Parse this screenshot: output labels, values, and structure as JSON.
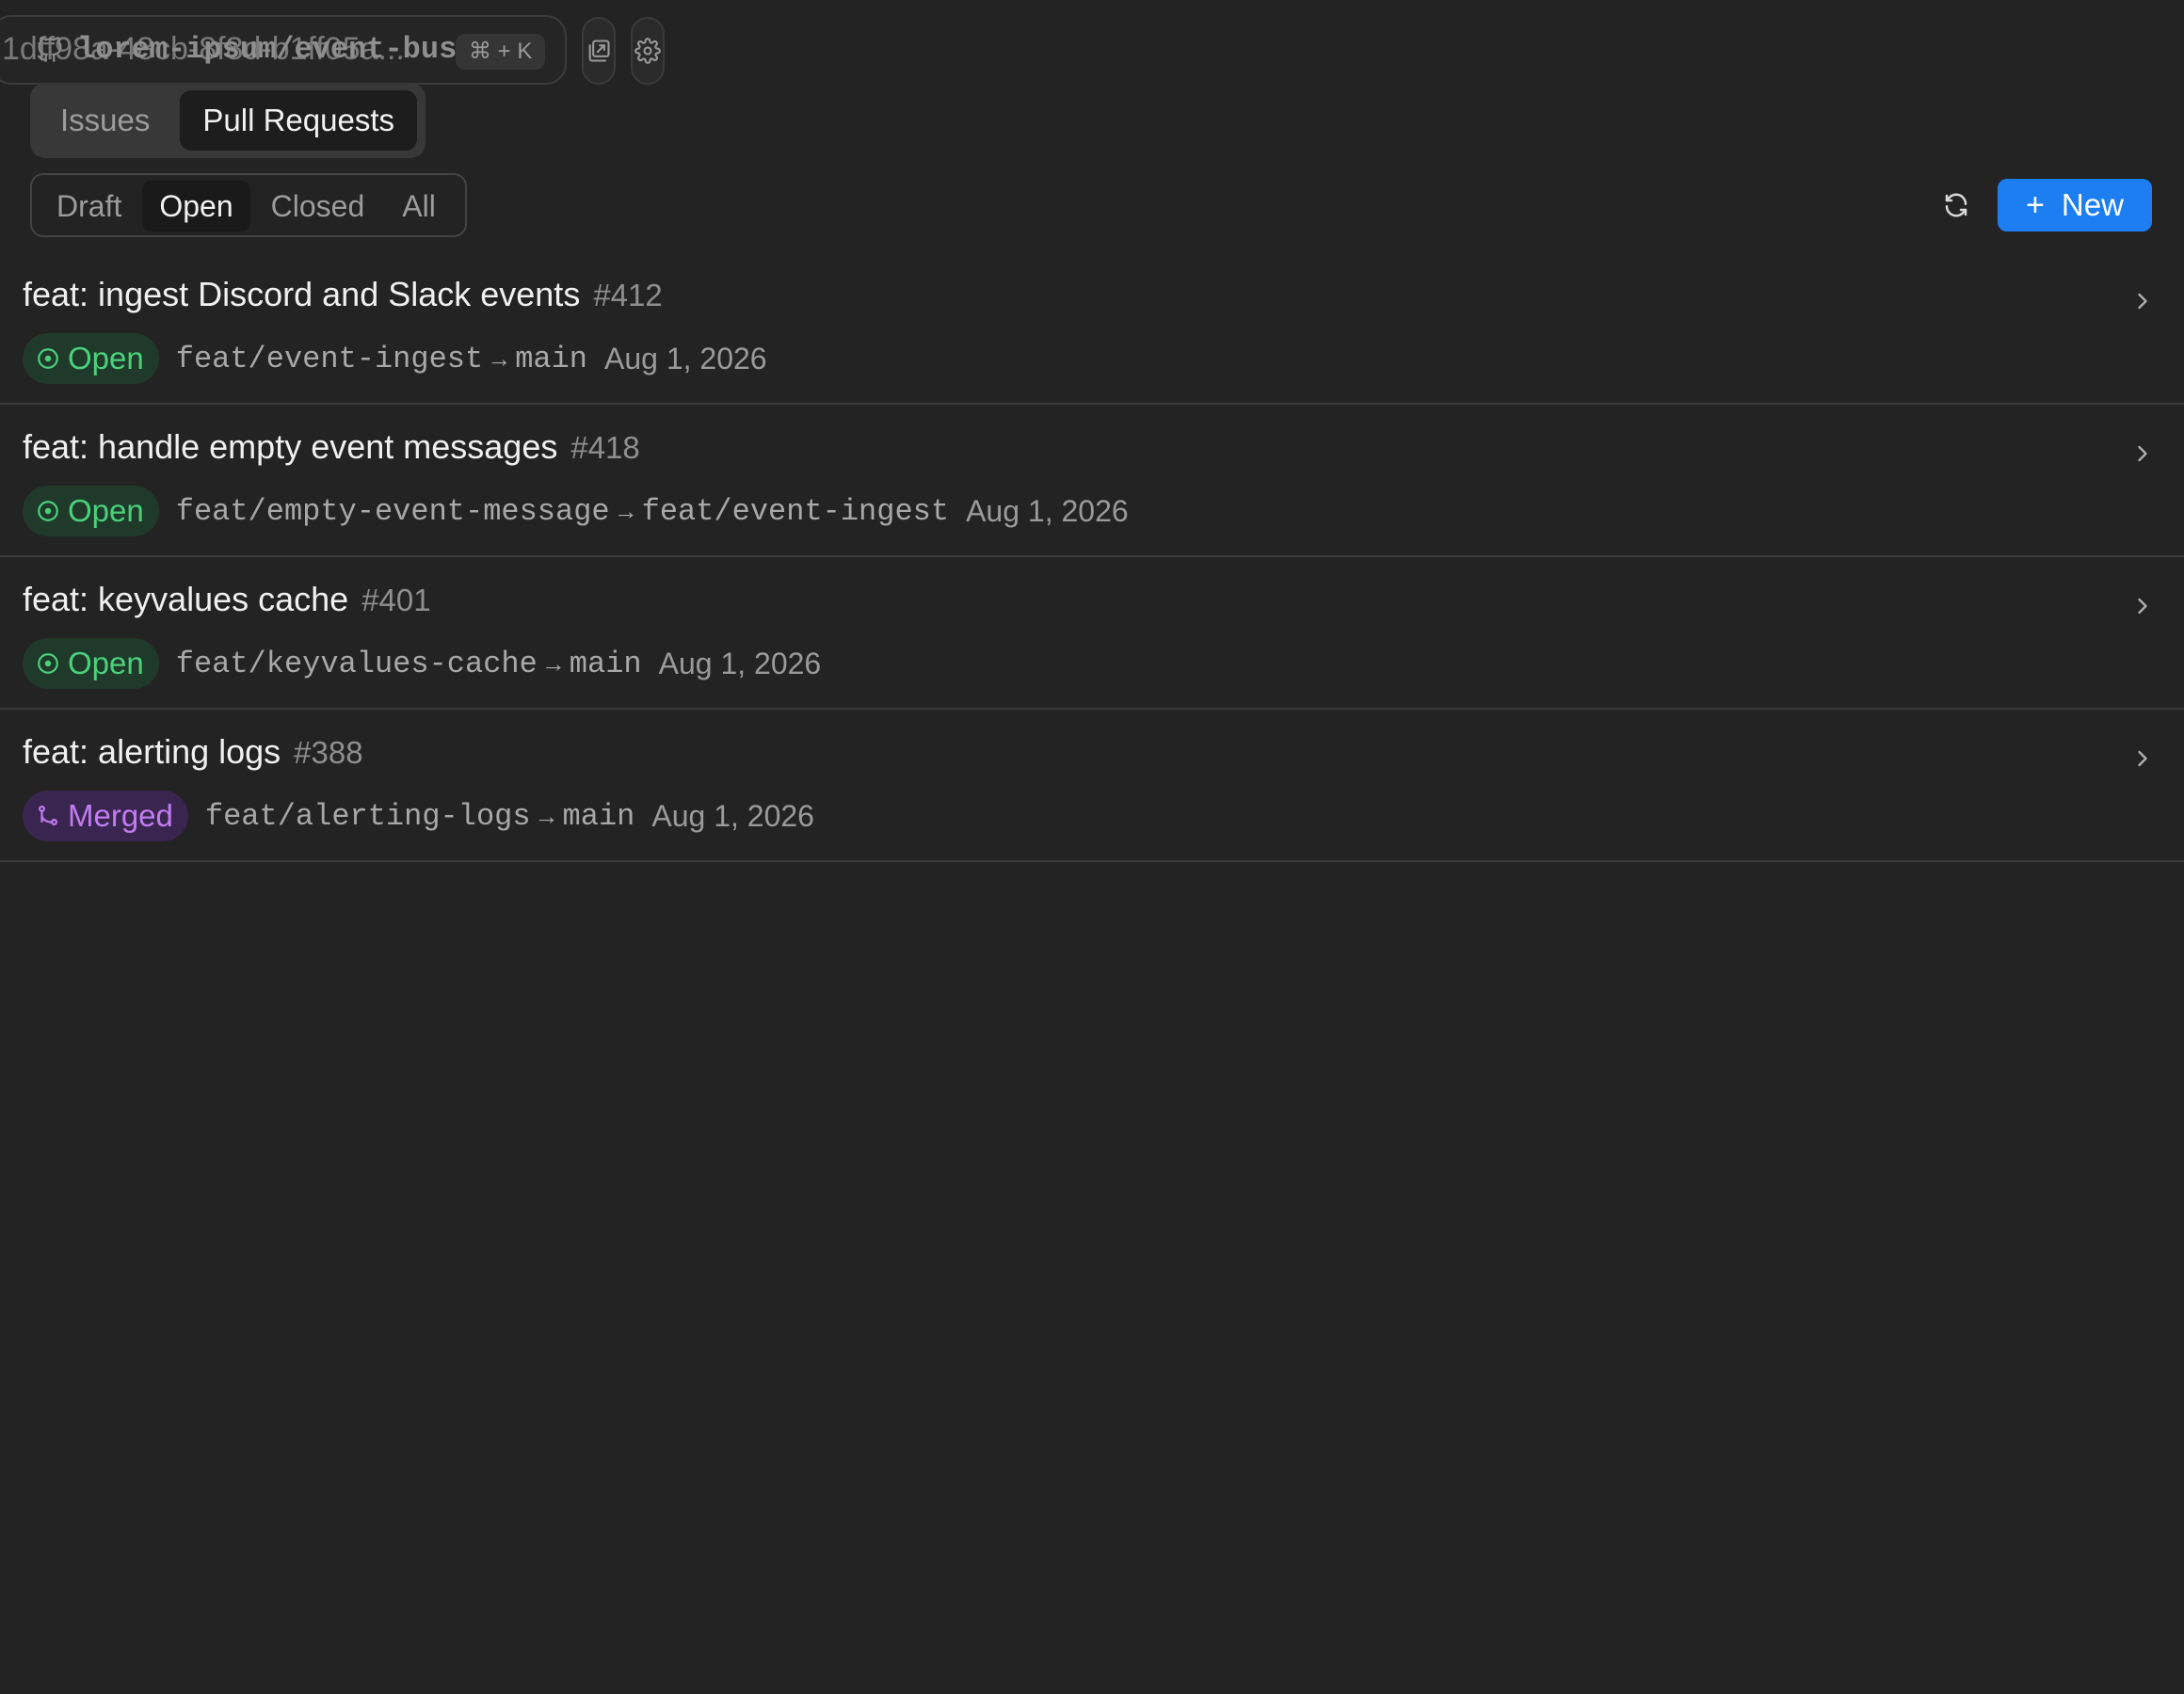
{
  "topbar": {
    "ghost_text": "1dff98a-48cb-8f8d-b1ff05a...",
    "repo_name": "lorem-ipsum/event-bus",
    "shortcut": "⌘ + K"
  },
  "main_tabs": [
    {
      "label": "Issues"
    },
    {
      "label": "Pull Requests"
    }
  ],
  "filters": [
    {
      "label": "Draft"
    },
    {
      "label": "Open"
    },
    {
      "label": "Closed"
    },
    {
      "label": "All"
    }
  ],
  "new_button": {
    "label": "New"
  },
  "pull_requests": [
    {
      "title": "feat: ingest Discord and Slack events",
      "number": "#412",
      "status": "Open",
      "source": "feat/event-ingest",
      "target": "main",
      "date": "Aug 1, 2026"
    },
    {
      "title": "feat: handle empty event messages",
      "number": "#418",
      "status": "Open",
      "source": "feat/empty-event-message",
      "target": "feat/event-ingest",
      "date": "Aug 1, 2026"
    },
    {
      "title": "feat: keyvalues cache",
      "number": "#401",
      "status": "Open",
      "source": "feat/keyvalues-cache",
      "target": "main",
      "date": "Aug 1, 2026"
    },
    {
      "title": "feat: alerting logs",
      "number": "#388",
      "status": "Merged",
      "source": "feat/alerting-logs",
      "target": "main",
      "date": "Aug 1, 2026"
    }
  ],
  "arrow": "→",
  "colors": {
    "background": "#232323",
    "accent": "#1c7ef0",
    "open": "#4cd07d",
    "merged": "#c07cf0"
  }
}
